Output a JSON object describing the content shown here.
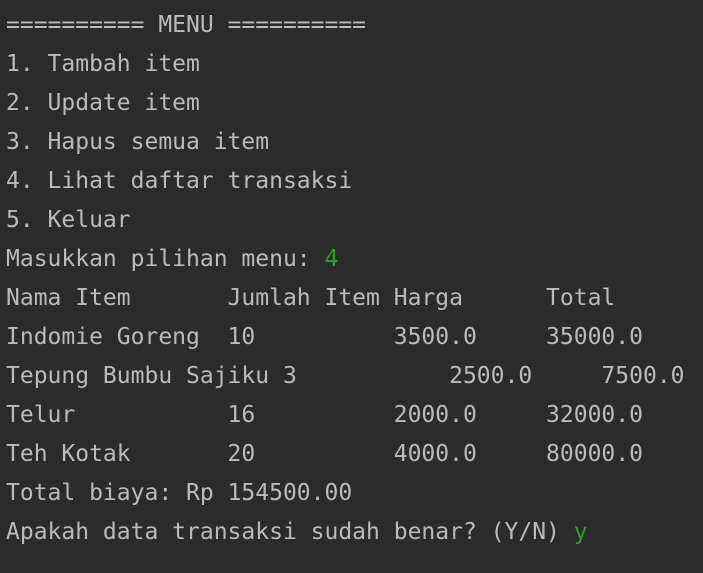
{
  "colors": {
    "background": "#2b2b2b",
    "text": "#bbbbbb",
    "user_input": "#2f9e2f"
  },
  "console": {
    "menu_header": "========== MENU ==========",
    "menu_items": [
      "1. Tambah item",
      "2. Update item",
      "3. Hapus semua item",
      "4. Lihat daftar transaksi",
      "5. Keluar"
    ],
    "prompt_menu": {
      "text": "Masukkan pilihan menu: ",
      "input": "4"
    },
    "table": {
      "header": "Nama Item       Jumlah Item Harga      Total",
      "rows": [
        "Indomie Goreng  10          3500.0     35000.0",
        "Tepung Bumbu Sajiku 3           2500.0     7500.0",
        "Telur           16          2000.0     32000.0",
        "Teh Kotak       20          4000.0     80000.0"
      ]
    },
    "total_line": "Total biaya: Rp 154500.00",
    "confirm_prompt": {
      "text": "Apakah data transaksi sudah benar? (Y/N) ",
      "input": "y"
    }
  }
}
